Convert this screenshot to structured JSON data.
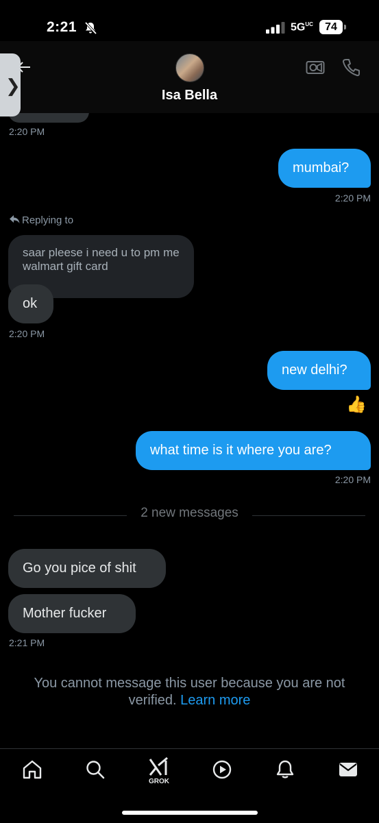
{
  "status_bar": {
    "time": "2:21",
    "network": "5G",
    "network_suffix": "UC",
    "battery": "74"
  },
  "header": {
    "contact_name": "Isa Bella",
    "side_tab_glyph": "❯"
  },
  "messages": {
    "time_top": "2:20 PM",
    "out_1": "mumbai?",
    "time_out_1": "2:20 PM",
    "reply_label": "Replying to",
    "quoted_text": "saar pleese i need u to pm me walmart gift card",
    "in_1": "ok",
    "time_in_1": "2:20 PM",
    "out_2": "new delhi?",
    "reaction": "👍",
    "out_3": "what time is it where you are?",
    "time_out_3": "2:20 PM",
    "new_messages_divider": "2 new messages",
    "in_2": "Go you pice of shit",
    "in_3": "Mother fucker",
    "time_in_3": "2:21 PM"
  },
  "notice": {
    "text": "You cannot message this user because you are not verified.",
    "link": "Learn more"
  },
  "nav": {
    "grok_label": "GROK",
    "icons": [
      "home-icon",
      "search-icon",
      "grok-icon",
      "play-icon",
      "notifications-icon",
      "messages-icon"
    ]
  },
  "colors": {
    "accent": "#1d9bf0",
    "incoming_bubble": "#2f3336",
    "background": "#000000"
  }
}
